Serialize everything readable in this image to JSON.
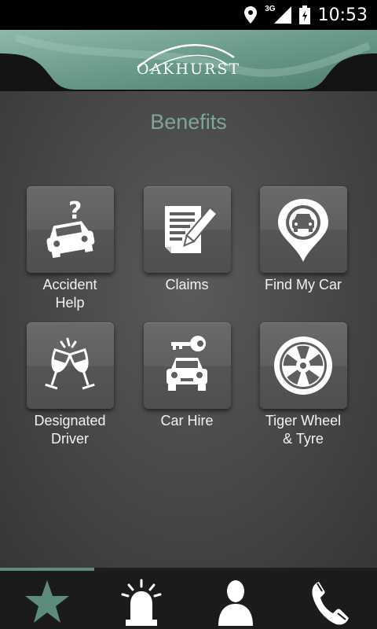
{
  "status_bar": {
    "network": "3G",
    "time": "10:53",
    "icons": [
      "location-icon",
      "signal-icon",
      "battery-icon"
    ]
  },
  "header": {
    "logo_text": "OAKHURST",
    "accent_color": "#5e8c7c"
  },
  "page": {
    "title": "Benefits",
    "title_color": "#7fa597"
  },
  "benefits": [
    {
      "label_line1": "Accident",
      "label_line2": "Help",
      "icon": "accident-car-icon"
    },
    {
      "label_line1": "Claims",
      "label_line2": "",
      "icon": "claims-document-icon"
    },
    {
      "label_line1": "Find My Car",
      "label_line2": "",
      "icon": "car-location-pin-icon"
    },
    {
      "label_line1": "Designated",
      "label_line2": "Driver",
      "icon": "wine-glasses-icon"
    },
    {
      "label_line1": "Car Hire",
      "label_line2": "",
      "icon": "car-key-icon"
    },
    {
      "label_line1": "Tiger Wheel",
      "label_line2": "& Tyre",
      "icon": "wheel-icon"
    }
  ],
  "tabs": [
    {
      "icon": "star-icon",
      "active": true
    },
    {
      "icon": "siren-icon",
      "active": false
    },
    {
      "icon": "person-icon",
      "active": false
    },
    {
      "icon": "phone-icon",
      "active": false
    }
  ]
}
